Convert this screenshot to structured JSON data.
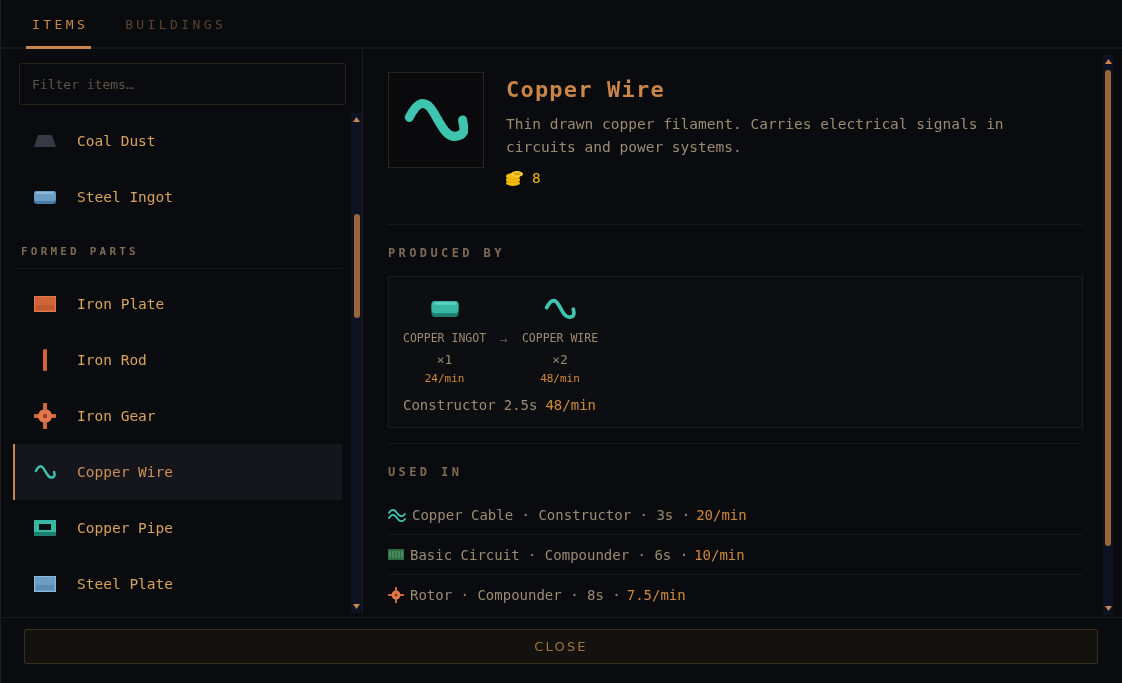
{
  "tabs": [
    {
      "label": "ITEMS",
      "selected": true
    },
    {
      "label": "BUILDINGS",
      "selected": false
    }
  ],
  "filter": {
    "placeholder": "Filter items…"
  },
  "item_list": {
    "groups": [
      {
        "items": [
          {
            "label": "Coal Dust",
            "selected": false
          },
          {
            "label": "Steel Ingot",
            "selected": false
          }
        ]
      },
      {
        "title": "FORMED PARTS",
        "items": [
          {
            "label": "Iron Plate",
            "selected": false
          },
          {
            "label": "Iron Rod",
            "selected": false
          },
          {
            "label": "Iron Gear",
            "selected": false
          },
          {
            "label": "Copper Wire",
            "selected": true
          },
          {
            "label": "Copper Pipe",
            "selected": false
          },
          {
            "label": "Steel Plate",
            "selected": false
          }
        ]
      }
    ]
  },
  "detail": {
    "name": "Copper Wire",
    "description": "Thin drawn copper filament. Carries electrical signals in circuits and power systems.",
    "price": "8"
  },
  "produced_by": {
    "title": "PRODUCED BY",
    "inputs": [
      {
        "name": "COPPER INGOT",
        "amount": "×1",
        "rate": "24/min"
      }
    ],
    "arrow": "→",
    "outputs": [
      {
        "name": "COPPER WIRE",
        "amount": "×2",
        "rate": "48/min"
      }
    ],
    "building": "Constructor",
    "time": "2.5s",
    "rate": "48/min"
  },
  "used_in": {
    "title": "USED IN",
    "rows": [
      {
        "text": "Copper Cable · Constructor · 3s ·",
        "rate": "20/min"
      },
      {
        "text": "Basic Circuit · Compounder · 6s ·",
        "rate": "10/min"
      },
      {
        "text": "Rotor · Compounder · 8s ·",
        "rate": "7.5/min"
      }
    ]
  },
  "footer": {
    "close_button": "CLOSE"
  }
}
